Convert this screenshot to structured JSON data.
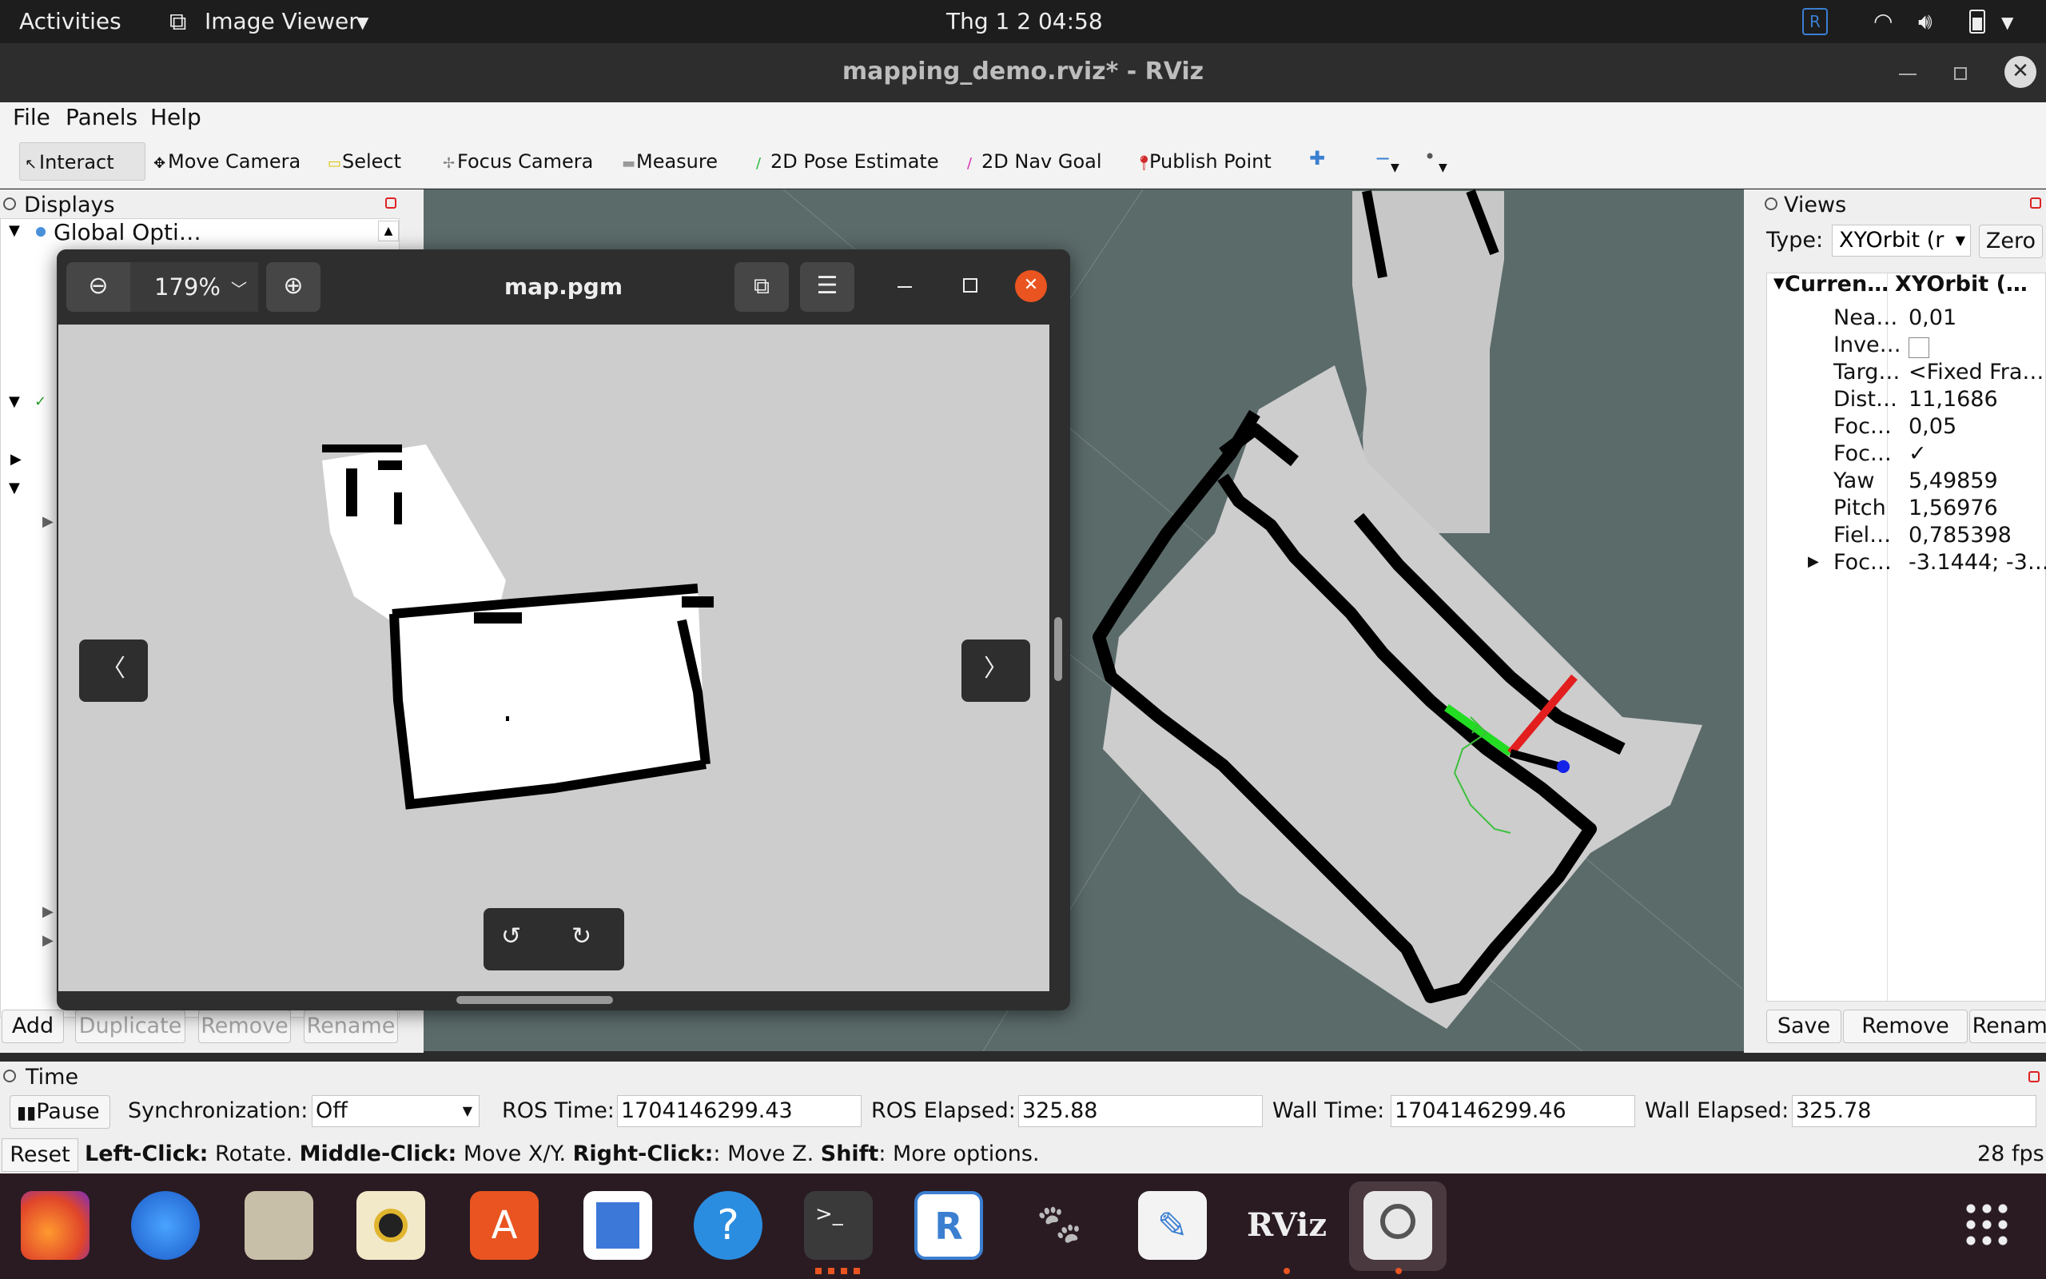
{
  "topbar": {
    "activities": "Activities",
    "app_name": "Image Viewer",
    "clock": "Thg 1 2  04:58"
  },
  "window": {
    "title": "mapping_demo.rviz* - RViz"
  },
  "menu": {
    "file": "File",
    "panels": "Panels",
    "help": "Help"
  },
  "toolbar": {
    "interact": "Interact",
    "move_camera": "Move Camera",
    "select": "Select",
    "focus_camera": "Focus Camera",
    "measure": "Measure",
    "pose_estimate": "2D Pose Estimate",
    "nav_goal": "2D Nav Goal",
    "publish_point": "Publish Point"
  },
  "displays": {
    "title": "Displays",
    "first_item": "Global Opti…",
    "buttons": {
      "add": "Add",
      "duplicate": "Duplicate",
      "remove": "Remove",
      "rename": "Rename"
    }
  },
  "image_viewer": {
    "zoom": "179%",
    "filename": "map.pgm"
  },
  "views": {
    "title": "Views",
    "type_label": "Type:",
    "type_value": "XYOrbit (r",
    "zero": "Zero",
    "current_label": "Curren…",
    "current_value": "XYOrbit (…",
    "props": [
      {
        "name": "Nea…",
        "value": "0,01"
      },
      {
        "name": "Inve…",
        "value": ""
      },
      {
        "name": "Targ…",
        "value": "<Fixed Fra…"
      },
      {
        "name": "Dist…",
        "value": "11,1686"
      },
      {
        "name": "Foc…",
        "value": "0,05"
      },
      {
        "name": "Foc…",
        "value": "✓"
      },
      {
        "name": "Yaw",
        "value": "5,49859"
      },
      {
        "name": "Pitch",
        "value": "1,56976"
      },
      {
        "name": "Fiel…",
        "value": "0,785398"
      },
      {
        "name": "Foc…",
        "value": "-3.1444; -3…"
      }
    ],
    "buttons": {
      "save": "Save",
      "remove": "Remove",
      "rename": "Rename"
    }
  },
  "time": {
    "title": "Time",
    "pause": "Pause",
    "sync_label": "Synchronization:",
    "sync_value": "Off",
    "ros_time_label": "ROS Time:",
    "ros_time": "1704146299.43",
    "ros_elapsed_label": "ROS Elapsed:",
    "ros_elapsed": "325.88",
    "wall_time_label": "Wall Time:",
    "wall_time": "1704146299.46",
    "wall_elapsed_label": "Wall Elapsed:",
    "wall_elapsed": "325.78"
  },
  "status": {
    "reset": "Reset",
    "k1": "Left-Click:",
    "v1": " Rotate. ",
    "k2": "Middle-Click:",
    "v2": " Move X/Y. ",
    "k3": "Right-Click:",
    "v3": ": Move Z. ",
    "k4": "Shift",
    "v4": ": More options.",
    "fps": "28 fps"
  },
  "dock": {
    "rviz": "RViz"
  },
  "colors": {
    "ubuntu_orange": "#e95420",
    "viewport_bg": "#5b6b6a",
    "map_free": "#cdcdcd"
  }
}
